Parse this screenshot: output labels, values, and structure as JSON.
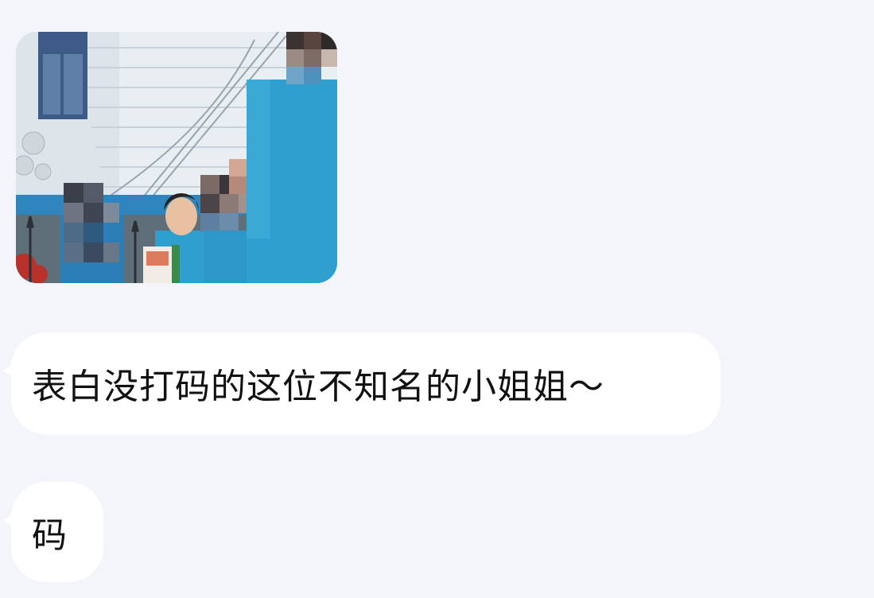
{
  "chat": {
    "image_message": {
      "icon": "photo-thumbnail"
    },
    "messages": [
      {
        "text": "表白没打码的这位不知名的小姐姐～"
      },
      {
        "text": "码"
      }
    ]
  },
  "colors": {
    "background": "#f4f5fa",
    "bubble": "#ffffff",
    "text": "#111111",
    "shirt_blue": "#2f9fcf"
  }
}
